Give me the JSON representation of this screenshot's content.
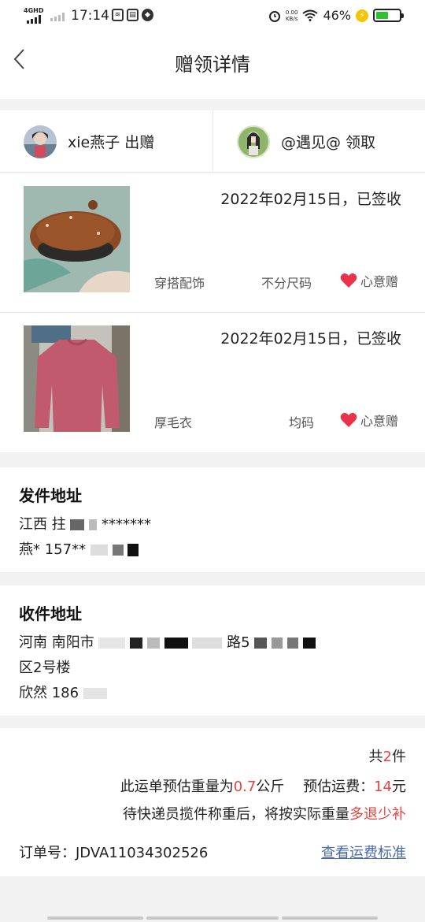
{
  "status_bar": {
    "network": "4GHD",
    "time": "17:14",
    "speed": "0.00",
    "speed_unit": "KB/s",
    "battery": "46%",
    "battery_level": 0.46
  },
  "header": {
    "title": "赠领详情"
  },
  "users": {
    "giver": {
      "name": "xie燕子 出赠"
    },
    "receiver": {
      "name": "@遇见@ 领取"
    }
  },
  "items": [
    {
      "date_status": "2022年02月15日，已签收",
      "category": "穿搭配饰",
      "size": "不分尺码",
      "gift_label": "心意赠"
    },
    {
      "date_status": "2022年02月15日，已签收",
      "category": "厚毛衣",
      "size": "均码",
      "gift_label": "心意赠"
    }
  ],
  "sender": {
    "heading": "发件地址",
    "line1": "江西 拄",
    "line1_tail": "*******",
    "line2": "燕* 157**"
  },
  "receiver_address": {
    "heading": "收件地址",
    "line1": "河南 南阳市",
    "line1_mid": "路5",
    "line2": "区2号楼",
    "line3": "欣然 186"
  },
  "summary": {
    "count_prefix": "共",
    "count": "2",
    "count_suffix": "件",
    "weight_prefix": "此运单预估重量为",
    "weight": "0.7",
    "weight_unit": "公斤",
    "fee_label": "预估运费：",
    "fee": "14",
    "fee_unit": "元",
    "note_prefix": "待快递员揽件称重后，将按实际重量",
    "note_highlight": "多退少补",
    "order_label": "订单号：",
    "order_number": "JDVA11034302526",
    "fee_link": "查看运费标准"
  },
  "colors": {
    "accent_red": "#e8433f",
    "link_blue": "#4a6ba8"
  }
}
